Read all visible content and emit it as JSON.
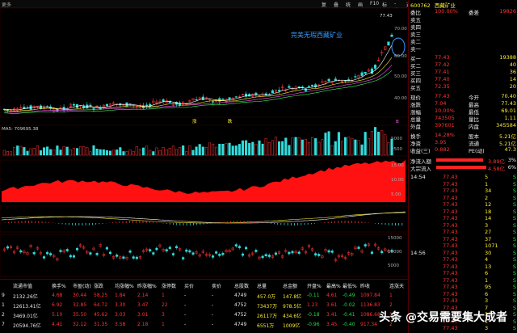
{
  "topbar": {
    "menu_label": "更多",
    "buttons": [
      "复权",
      "叠加",
      "统计",
      "画线",
      "F10",
      "标记",
      "-自选",
      "返回"
    ]
  },
  "quote": {
    "code": "600762",
    "name": "西藏矿业",
    "rows": [
      {
        "label": "委比",
        "v1": "100.00%",
        "l2": "委差",
        "v2": "19826"
      },
      {
        "label": "卖五",
        "v1": "",
        "l2": "",
        "v2": ""
      },
      {
        "label": "卖四",
        "v1": "",
        "l2": "",
        "v2": ""
      },
      {
        "label": "卖三",
        "v1": "",
        "l2": "",
        "v2": ""
      },
      {
        "label": "卖二",
        "v1": "",
        "l2": "",
        "v2": ""
      },
      {
        "label": "卖一",
        "v1": "",
        "l2": "",
        "v2": ""
      },
      {
        "label": "买一",
        "v1": "77.43",
        "l2": "",
        "v2": "19388"
      },
      {
        "label": "买二",
        "v1": "77.42",
        "l2": "",
        "v2": "40"
      },
      {
        "label": "买三",
        "v1": "77.41",
        "l2": "",
        "v2": "36"
      },
      {
        "label": "买四",
        "v1": "77.40",
        "l2": "",
        "v2": "14"
      },
      {
        "label": "买五",
        "v1": "72.35",
        "l2": "",
        "v2": "20"
      },
      {
        "label": "现价",
        "v1": "77.43",
        "l2": "今开",
        "v2": "70.40"
      },
      {
        "label": "涨跌",
        "v1": "7.04",
        "l2": "最高",
        "v2": "77.43"
      },
      {
        "label": "涨幅",
        "v1": "10.00%",
        "l2": "最低",
        "v2": "69.01"
      },
      {
        "label": "总量",
        "v1": "743505",
        "l2": "量比",
        "v2": "1.11"
      },
      {
        "label": "外盘",
        "v1": "397601",
        "l2": "内盘",
        "v2": "345584"
      },
      {
        "label": "换手",
        "v1": "14.28%",
        "l2": "股本",
        "v2": "5.21亿"
      },
      {
        "label": "净资",
        "v1": "3.95",
        "l2": "流通",
        "v2": "5.21亿"
      },
      {
        "label": "收益(三)",
        "v1": "0.882",
        "l2": "PE(动)",
        "v2": "47.3"
      }
    ],
    "flow": [
      {
        "label": "净流入额",
        "value": "3.89亿",
        "pct": "3%"
      },
      {
        "label": "大宗流入",
        "value": "4.58亿",
        "pct": "6%"
      }
    ]
  },
  "ticks": [
    {
      "time": "14:54",
      "price": "77.43",
      "vol": "5",
      "side": "S"
    },
    {
      "time": "",
      "price": "77.43",
      "vol": "1",
      "side": "S"
    },
    {
      "time": "",
      "price": "77.43",
      "vol": "34",
      "side": "S"
    },
    {
      "time": "",
      "price": "77.43",
      "vol": "2",
      "side": "S"
    },
    {
      "time": "",
      "price": "77.43",
      "vol": "12",
      "side": "S"
    },
    {
      "time": "",
      "price": "77.43",
      "vol": "18",
      "side": "S"
    },
    {
      "time": "",
      "price": "77.43",
      "vol": "14",
      "side": "S"
    },
    {
      "time": "",
      "price": "77.43",
      "vol": "3",
      "side": "S"
    },
    {
      "time": "",
      "price": "77.43",
      "vol": "27",
      "side": "S"
    },
    {
      "time": "",
      "price": "77.43",
      "vol": "37",
      "side": "S"
    },
    {
      "time": "",
      "price": "77.43",
      "vol": "1071",
      "side": "S"
    },
    {
      "time": "14:56",
      "price": "77.43",
      "vol": "30",
      "side": "S"
    },
    {
      "time": "",
      "price": "77.43",
      "vol": "4",
      "side": "S"
    },
    {
      "time": "",
      "price": "77.43",
      "vol": "13",
      "side": "S"
    },
    {
      "time": "",
      "price": "77.43",
      "vol": "6",
      "side": "S"
    },
    {
      "time": "",
      "price": "77.43",
      "vol": "1",
      "side": "S"
    },
    {
      "time": "",
      "price": "77.43",
      "vol": "95",
      "side": "S"
    },
    {
      "time": "",
      "price": "77.43",
      "vol": "6",
      "side": "S"
    },
    {
      "time": "",
      "price": "77.43",
      "vol": "3",
      "side": "S"
    },
    {
      "time": "",
      "price": "77.43",
      "vol": "7",
      "side": "S"
    },
    {
      "time": "",
      "price": "77.43",
      "vol": "31",
      "side": "S"
    },
    {
      "time": "",
      "price": "77.43",
      "vol": "1",
      "side": "S"
    },
    {
      "time": "",
      "price": "77.43",
      "vol": "3",
      "side": "S"
    }
  ],
  "chart": {
    "annotation": "完美无瑕西藏矿业",
    "price_label": "77.43",
    "ma_label": "MA5: 709695.38",
    "price_axis": [
      "70.00",
      "60.00",
      "50.00",
      "40.00"
    ],
    "vol_axis": [
      "5000",
      "2500"
    ],
    "mid_axis": [
      "15.00",
      "10.00",
      "5.00"
    ],
    "bot_axis": [
      "15000",
      "10000",
      "5000"
    ],
    "bottom_marks": [
      "涨",
      "跌",
      "B"
    ]
  },
  "table": {
    "headers": [
      "",
      "流通市值",
      "换手%",
      "市盈(动)",
      "涨跌",
      "均涨幅%",
      "昨涨幅%",
      "涨停数",
      "买价",
      "卖价",
      "总股数",
      "总量",
      "总金额",
      "开盘%",
      "最高%",
      "最低%",
      "昨收",
      "连涨天"
    ],
    "rows": [
      [
        "9",
        "2132.26亿",
        "4.68",
        "30.44",
        "58.25",
        "1.84",
        "2.14",
        "1",
        "-",
        "-",
        "4749",
        "457.0万",
        "147.8亿",
        "-0.11",
        "4.61",
        "-0.49",
        "1097.84",
        "1"
      ],
      [
        "1",
        "12613.41亿",
        "6.92",
        "32.85",
        "64.72",
        "3.30",
        "3.47",
        "22",
        "-",
        "-",
        "4752",
        "73437万",
        "978.5亿",
        "1.23",
        "3.61",
        "-0.02",
        "1136.83",
        "2"
      ],
      [
        "2",
        "3469.01亿",
        "5.10",
        "35.50",
        "45.62",
        "3.03",
        "3.01",
        "3",
        "-",
        "-",
        "4752",
        "26117万",
        "434.6亿",
        "-0.18",
        "3.41",
        "-0.41",
        "1086.68",
        "1"
      ],
      [
        "7",
        "20594.76亿",
        "4.41",
        "32.12",
        "31.35",
        "3.58",
        "2.18",
        "1",
        "-",
        "-",
        "4749",
        "6551万",
        "1009亿",
        "-0.96",
        "3.45",
        "-0.40",
        "917.34",
        "2"
      ]
    ]
  },
  "watermark": "头条 @交易需要集大成者",
  "colors": {
    "up": "#ff3333",
    "down": "#33dddd",
    "accent": "#ffee33"
  }
}
